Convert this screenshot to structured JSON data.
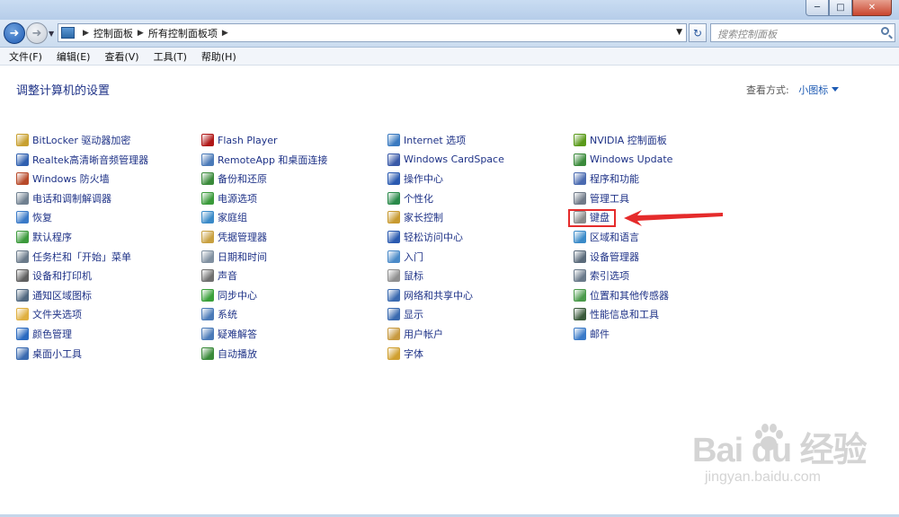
{
  "address": {
    "crumbs": [
      "控制面板",
      "所有控制面板项"
    ],
    "search_placeholder": "搜索控制面板"
  },
  "menu": [
    "文件(F)",
    "编辑(E)",
    "查看(V)",
    "工具(T)",
    "帮助(H)"
  ],
  "header": {
    "title": "调整计算机的设置",
    "view_by_label": "查看方式:",
    "view_by_value": "小图标"
  },
  "columns": [
    [
      {
        "label": "BitLocker 驱动器加密",
        "icon": "bitlocker-icon",
        "color": "#c8a030"
      },
      {
        "label": "Realtek高清晰音频管理器",
        "icon": "realtek-audio-icon",
        "color": "#3060b0"
      },
      {
        "label": "Windows 防火墙",
        "icon": "firewall-icon",
        "color": "#b84a2a"
      },
      {
        "label": "电话和调制解调器",
        "icon": "phone-modem-icon",
        "color": "#708090"
      },
      {
        "label": "恢复",
        "icon": "recovery-icon",
        "color": "#3a7ac8"
      },
      {
        "label": "默认程序",
        "icon": "default-programs-icon",
        "color": "#3c9a3c"
      },
      {
        "label": "任务栏和「开始」菜单",
        "icon": "taskbar-icon",
        "color": "#6a7a8a"
      },
      {
        "label": "设备和打印机",
        "icon": "printer-icon",
        "color": "#606060"
      },
      {
        "label": "通知区域图标",
        "icon": "notification-icon",
        "color": "#506880"
      },
      {
        "label": "文件夹选项",
        "icon": "folder-options-icon",
        "color": "#e0b040"
      },
      {
        "label": "颜色管理",
        "icon": "color-management-icon",
        "color": "#2a6ac0"
      },
      {
        "label": "桌面小工具",
        "icon": "gadgets-icon",
        "color": "#3a6ab0"
      }
    ],
    [
      {
        "label": "Flash Player",
        "icon": "flash-player-icon",
        "color": "#b01818"
      },
      {
        "label": "RemoteApp 和桌面连接",
        "icon": "remoteapp-icon",
        "color": "#4a7ab8"
      },
      {
        "label": "备份和还原",
        "icon": "backup-icon",
        "color": "#3a8a3a"
      },
      {
        "label": "电源选项",
        "icon": "power-icon",
        "color": "#3a9a3a"
      },
      {
        "label": "家庭组",
        "icon": "homegroup-icon",
        "color": "#3a8ac8"
      },
      {
        "label": "凭据管理器",
        "icon": "credential-icon",
        "color": "#c8a040"
      },
      {
        "label": "日期和时间",
        "icon": "clock-icon",
        "color": "#8090a0"
      },
      {
        "label": "声音",
        "icon": "speaker-icon",
        "color": "#707070"
      },
      {
        "label": "同步中心",
        "icon": "sync-icon",
        "color": "#3aa03a"
      },
      {
        "label": "系统",
        "icon": "system-icon",
        "color": "#4a7ab8"
      },
      {
        "label": "疑难解答",
        "icon": "troubleshoot-icon",
        "color": "#4a7ab8"
      },
      {
        "label": "自动播放",
        "icon": "autoplay-icon",
        "color": "#3a8a3a"
      }
    ],
    [
      {
        "label": "Internet 选项",
        "icon": "internet-options-icon",
        "color": "#3a7ac0"
      },
      {
        "label": "Windows CardSpace",
        "icon": "cardspace-icon",
        "color": "#3a5aa8"
      },
      {
        "label": "操作中心",
        "icon": "action-center-icon",
        "color": "#2a5ab0"
      },
      {
        "label": "个性化",
        "icon": "personalization-icon",
        "color": "#2a8a4a"
      },
      {
        "label": "家长控制",
        "icon": "parental-controls-icon",
        "color": "#c89a30"
      },
      {
        "label": "轻松访问中心",
        "icon": "ease-of-access-icon",
        "color": "#2a5ab0"
      },
      {
        "label": "入门",
        "icon": "getting-started-icon",
        "color": "#4a8ac8"
      },
      {
        "label": "鼠标",
        "icon": "mouse-icon",
        "color": "#909090"
      },
      {
        "label": "网络和共享中心",
        "icon": "network-icon",
        "color": "#3a6ab0"
      },
      {
        "label": "显示",
        "icon": "display-icon",
        "color": "#3a6ab0"
      },
      {
        "label": "用户帐户",
        "icon": "user-accounts-icon",
        "color": "#c89a40"
      },
      {
        "label": "字体",
        "icon": "fonts-icon",
        "color": "#d0a030"
      }
    ],
    [
      {
        "label": "NVIDIA 控制面板",
        "icon": "nvidia-icon",
        "color": "#5a9a1a"
      },
      {
        "label": "Windows Update",
        "icon": "windows-update-icon",
        "color": "#3a8a3a"
      },
      {
        "label": "程序和功能",
        "icon": "programs-icon",
        "color": "#4a6ab0"
      },
      {
        "label": "管理工具",
        "icon": "admin-tools-icon",
        "color": "#707a88"
      },
      {
        "label": "键盘",
        "icon": "keyboard-icon",
        "color": "#8a8a8a"
      },
      {
        "label": "区域和语言",
        "icon": "region-icon",
        "color": "#3a8ac8"
      },
      {
        "label": "设备管理器",
        "icon": "device-manager-icon",
        "color": "#5a6a7a"
      },
      {
        "label": "索引选项",
        "icon": "indexing-icon",
        "color": "#6a7a8a"
      },
      {
        "label": "位置和其他传感器",
        "icon": "sensors-icon",
        "color": "#4a9a4a"
      },
      {
        "label": "性能信息和工具",
        "icon": "performance-icon",
        "color": "#3a5a3a"
      },
      {
        "label": "邮件",
        "icon": "mail-icon",
        "color": "#3a7ac8"
      }
    ]
  ],
  "watermark": {
    "logo": "Bai du 经验",
    "sub": "jingyan.baidu.com"
  }
}
